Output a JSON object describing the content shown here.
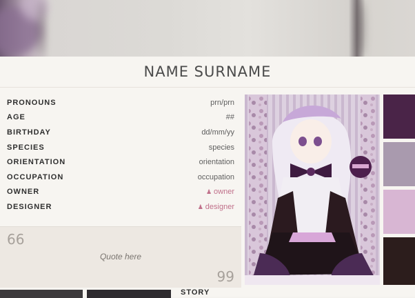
{
  "profile": {
    "name": "NAME SURNAME",
    "fields": [
      {
        "label": "PRONOUNS",
        "value": "prn/prn",
        "link": false
      },
      {
        "label": "AGE",
        "value": "##",
        "link": false
      },
      {
        "label": "BIRTHDAY",
        "value": "dd/mm/yy",
        "link": false
      },
      {
        "label": "SPECIES",
        "value": "species",
        "link": false
      },
      {
        "label": "ORIENTATION",
        "value": "orientation",
        "link": false
      },
      {
        "label": "OCCUPATION",
        "value": "occupation",
        "link": false
      },
      {
        "label": "OWNER",
        "value": "owner",
        "link": true
      },
      {
        "label": "DESIGNER",
        "value": "designer",
        "link": true
      }
    ],
    "quote": {
      "open_mark": "66",
      "text": "Quote here",
      "close_mark": "99"
    },
    "story_heading": "STORY"
  },
  "palette": [
    "#4a2448",
    "#a99aae",
    "#d8b6d3",
    "#2c1d1c"
  ],
  "icons": {
    "owner": "user-icon",
    "designer": "user-icon"
  }
}
